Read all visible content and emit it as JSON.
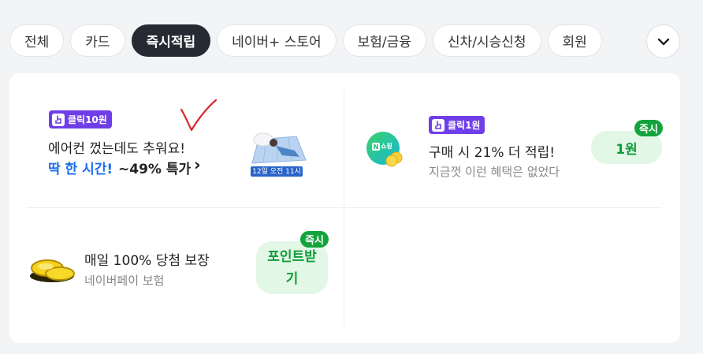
{
  "tabs": [
    {
      "label": "전체"
    },
    {
      "label": "카드"
    },
    {
      "label": "즉시적립",
      "active": true
    },
    {
      "label": "네이버+ 스토어"
    },
    {
      "label": "보험/금융"
    },
    {
      "label": "신차/시승신청"
    },
    {
      "label": "회원"
    }
  ],
  "more_button": {
    "icon": "chevron-down-icon"
  },
  "offers": {
    "aircon": {
      "badge": "클릭10원",
      "title": "에어컨 껐는데도 추워요!",
      "highlight": "딱 한 시간!",
      "discount": "~49% 특가",
      "chevron": "›",
      "image_caption": "12일 오전 11시"
    },
    "shopping": {
      "badge": "클릭1원",
      "logo_label": "쇼핑",
      "title": "구매 시 21% 더 적립!",
      "subtitle": "지금껏 이런 혜택은 없었다",
      "action_label": "1원",
      "instant_tag": "즉시"
    },
    "insurance": {
      "title": "매일 100% 당첨 보장",
      "subtitle": "네이버페이 보험",
      "action_label": "포인트받기",
      "instant_tag": "즉시"
    }
  },
  "colors": {
    "accent_purple": "#6f3ee8",
    "accent_blue": "#1a6ef0",
    "point_green": "#0f9d3a",
    "tab_active": "#262b33"
  }
}
